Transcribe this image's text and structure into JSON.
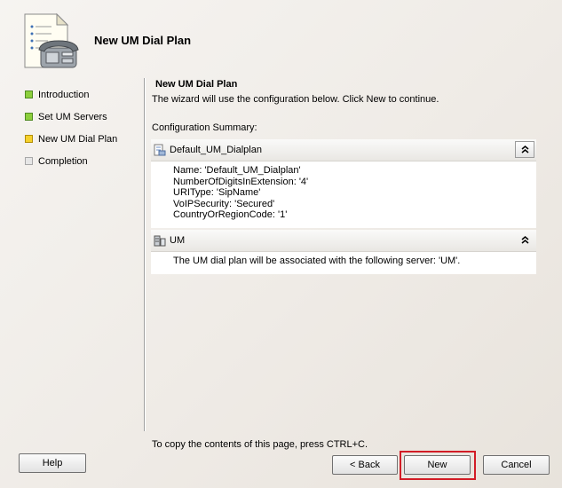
{
  "header": {
    "title": "New UM Dial Plan",
    "icon": "phone-document-icon"
  },
  "steps": [
    {
      "label": "Introduction",
      "status": "done"
    },
    {
      "label": "Set UM Servers",
      "status": "done"
    },
    {
      "label": "New UM Dial Plan",
      "status": "current"
    },
    {
      "label": "Completion",
      "status": "pending"
    }
  ],
  "page": {
    "title": "New UM Dial Plan",
    "description": "The wizard will use the configuration below.  Click New to continue.",
    "summary_label": "Configuration Summary:",
    "sections": [
      {
        "title": "Default_UM_Dialplan",
        "icon": "dialplan-icon",
        "lines": [
          "Name: 'Default_UM_Dialplan'",
          "NumberOfDigitsInExtension: '4'",
          "URIType: 'SipName'",
          "VoIPSecurity: 'Secured'",
          "CountryOrRegionCode: '1'"
        ]
      },
      {
        "title": "UM",
        "icon": "server-icon",
        "lines": [
          "The UM dial plan will be associated with the following server: 'UM'."
        ]
      }
    ],
    "collapse_glyph": "⌃",
    "footer_note": "To copy the contents of this page, press CTRL+C."
  },
  "buttons": {
    "help": "Help",
    "back": "< Back",
    "new": "New",
    "cancel": "Cancel"
  },
  "colors": {
    "highlight": "#d21c26",
    "step_done": "#8ccf3c",
    "step_current": "#f5d12b"
  }
}
